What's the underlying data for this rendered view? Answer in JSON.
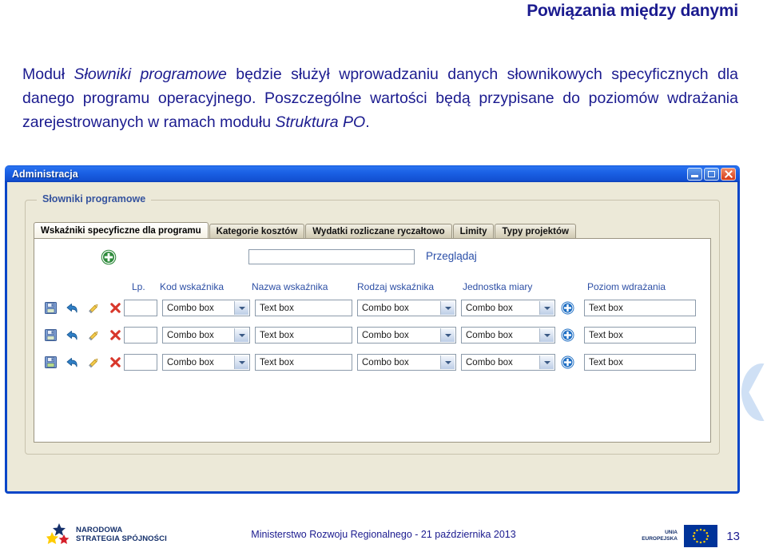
{
  "slide": {
    "title": "Powiązania między danymi",
    "body": {
      "line1_a": "Moduł ",
      "line1_em": "Słowniki programowe",
      "line1_b": " będzie służył wprowadzaniu danych słownikowych specyficznych dla danego programu operacyjnego. Poszczególne wartości będą przypisane do poziomów wdrażania zarejestrowanych w ramach modułu ",
      "line2_em": "Struktura PO",
      "line2_end": "."
    }
  },
  "window": {
    "title": "Administracja",
    "controls": {
      "minimize": "minimize-button",
      "maximize": "maximize-button",
      "close": "close-button"
    },
    "groupbox_legend": "Słowniki programowe",
    "tabs": [
      {
        "label": "Wskaźniki specyficzne dla programu",
        "active": true
      },
      {
        "label": "Kategorie kosztów",
        "active": false
      },
      {
        "label": "Wydatki rozliczane ryczałtowo",
        "active": false
      },
      {
        "label": "Limity",
        "active": false
      },
      {
        "label": "Typy projektów",
        "active": false
      }
    ],
    "toolbar": {
      "add_icon": "add-circle-green-icon",
      "search_value": "",
      "search_placeholder": "",
      "browse_label": "Przeglądaj"
    },
    "grid": {
      "columns": [
        "Lp.",
        "Kod wskaźnika",
        "Nazwa wskaźnika",
        "Rodzaj wskaźnika",
        "Jednostka miary",
        "Poziom wdrażania"
      ],
      "row_actions": [
        "save-icon",
        "undo-icon",
        "edit-icon",
        "delete-icon"
      ],
      "rows": [
        {
          "lp": "",
          "kod": "Combo box",
          "nazwa": "Text box",
          "rodzaj": "Combo box",
          "jednostka": "Combo box",
          "poziom_add_icon": "add-circle-blue-icon",
          "poziom": "Text box"
        },
        {
          "lp": "",
          "kod": "Combo box",
          "nazwa": "Text box",
          "rodzaj": "Combo box",
          "jednostka": "Combo box",
          "poziom_add_icon": "add-circle-blue-icon",
          "poziom": "Text box"
        },
        {
          "lp": "",
          "kod": "Combo box",
          "nazwa": "Text box",
          "rodzaj": "Combo box",
          "jednostka": "Combo box",
          "poziom_add_icon": "add-circle-blue-icon",
          "poziom": "Text box"
        }
      ]
    }
  },
  "footer": {
    "nss_line1": "NARODOWA",
    "nss_line2": "STRATEGIA SPÓJNOŚCI",
    "center_text": "Ministerstwo Rozwoju Regionalnego - 21 października 2013",
    "eu_line1": "UNIA",
    "eu_line2": "EUROPEJSKA",
    "page_number": "13"
  },
  "colors": {
    "heading": "#1b1b8f",
    "titlebar": "#1b62e6",
    "window_face": "#ece9d8",
    "tab_text": "#111111",
    "grid_header": "#2d4fa5",
    "link": "#2b4fa8",
    "eu_blue": "#003399",
    "eu_yellow": "#ffcc00"
  }
}
